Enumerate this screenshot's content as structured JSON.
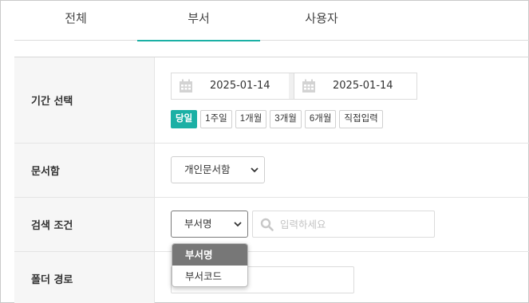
{
  "tabs": [
    {
      "label": "전체",
      "active": false
    },
    {
      "label": "부서",
      "active": true
    },
    {
      "label": "사용자",
      "active": false
    }
  ],
  "accent_color": "#1bb0a5",
  "form": {
    "period": {
      "label": "기간 선택",
      "start_date": "2025-01-14",
      "separator": "-",
      "end_date": "2025-01-14",
      "icon": "calendar-icon",
      "quick_buttons": [
        {
          "label": "당일",
          "active": true
        },
        {
          "label": "1주일",
          "active": false
        },
        {
          "label": "1개월",
          "active": false
        },
        {
          "label": "3개월",
          "active": false
        },
        {
          "label": "6개월",
          "active": false
        },
        {
          "label": "직접입력",
          "active": false
        }
      ]
    },
    "docbox": {
      "label": "문서함",
      "selected": "개인문서함"
    },
    "search": {
      "label": "검색 조건",
      "selected": "부서명",
      "placeholder": "입력하세요",
      "icon": "search-icon",
      "options": [
        "부서명",
        "부서코드"
      ],
      "highlighted_option": "부서명"
    },
    "folder_path": {
      "label": "폴더 경로",
      "value": ""
    }
  }
}
